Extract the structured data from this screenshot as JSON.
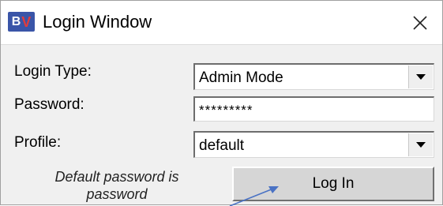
{
  "window": {
    "logo_text_b": "B",
    "logo_text_v": "V",
    "title": "Login Window",
    "close_icon": "close-icon"
  },
  "form": {
    "login_type_label": "Login Type:",
    "login_type_value": "Admin Mode",
    "password_label": "Password:",
    "password_value": "*********",
    "profile_label": "Profile:",
    "profile_value": "default"
  },
  "hint_text": "Default password is password",
  "login_button_label": "Log In",
  "colors": {
    "arrow": "#4a72c4",
    "logo_bg": "#3a55a8"
  }
}
